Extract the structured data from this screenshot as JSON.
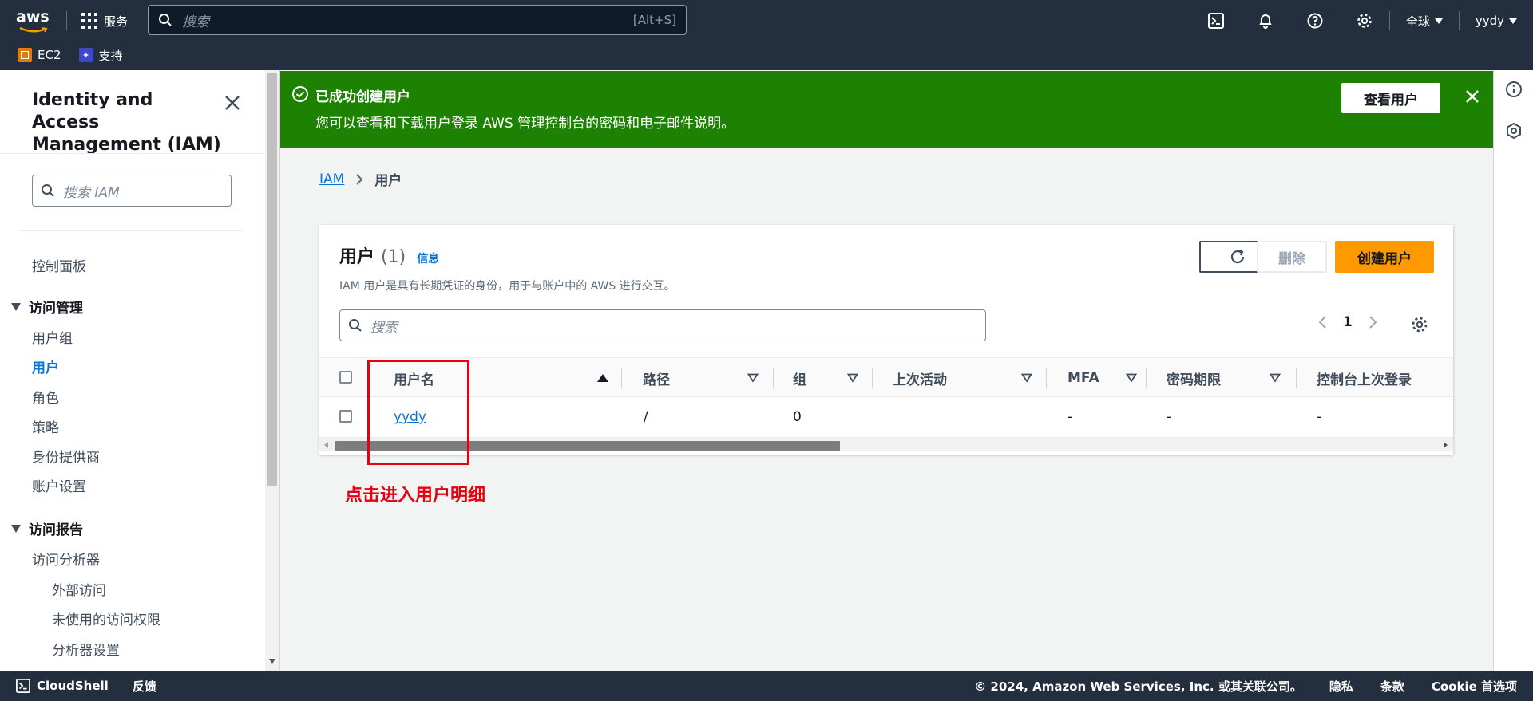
{
  "topnav": {
    "logo": "aws",
    "services_label": "服务",
    "search_placeholder": "搜索",
    "search_shortcut": "[Alt+S]",
    "region": "全球",
    "account": "yydy",
    "favorites": [
      {
        "label": "EC2",
        "icon": "ec2-icon"
      },
      {
        "label": "支持",
        "icon": "support-icon"
      }
    ],
    "icons": [
      "cloudshell-icon",
      "notifications-icon",
      "help-icon",
      "settings-icon"
    ]
  },
  "sidebar": {
    "title": "Identity and Access Management (IAM)",
    "search_placeholder": "搜索 IAM",
    "dashboard": "控制面板",
    "section_access_management": "访问管理",
    "access_items": [
      "用户组",
      "用户",
      "角色",
      "策略",
      "身份提供商",
      "账户设置"
    ],
    "active_item": "用户",
    "section_access_reports": "访问报告",
    "report_items": [
      "访问分析器"
    ],
    "analyzer_sub_items": [
      "外部访问",
      "未使用的访问权限",
      "分析器设置"
    ]
  },
  "flash": {
    "title": "已成功创建用户",
    "description": "您可以查看和下载用户登录 AWS 管理控制台的密码和电子邮件说明。",
    "button": "查看用户",
    "color": "#1d8102"
  },
  "breadcrumb": {
    "root": "IAM",
    "current": "用户"
  },
  "users_panel": {
    "title": "用户",
    "count": "(1)",
    "info": "信息",
    "description": "IAM 用户是具有长期凭证的身份，用于与账户中的 AWS 进行交互。",
    "refresh_icon": "refresh-icon",
    "delete_label": "删除",
    "create_label": "创建用户",
    "search_placeholder": "搜索",
    "page": "1",
    "columns": [
      "用户名",
      "路径",
      "组",
      "上次活动",
      "MFA",
      "密码期限",
      "控制台上次登录"
    ],
    "rows": [
      {
        "username": "yydy",
        "path": "/",
        "groups": "0",
        "last_activity": "",
        "mfa": "-",
        "password_age": "-",
        "console_last_login": "-"
      }
    ]
  },
  "annotation": {
    "text": "点击进入用户明细",
    "color": "#e60012"
  },
  "footer": {
    "cloudshell": "CloudShell",
    "feedback": "反馈",
    "copyright": "© 2024, Amazon Web Services, Inc. 或其关联公司。",
    "privacy": "隐私",
    "terms": "条款",
    "cookie": "Cookie 首选项"
  },
  "colors": {
    "nav_bg": "#232f3e",
    "primary": "#ff9900",
    "link": "#0972d3",
    "success": "#1d8102"
  }
}
